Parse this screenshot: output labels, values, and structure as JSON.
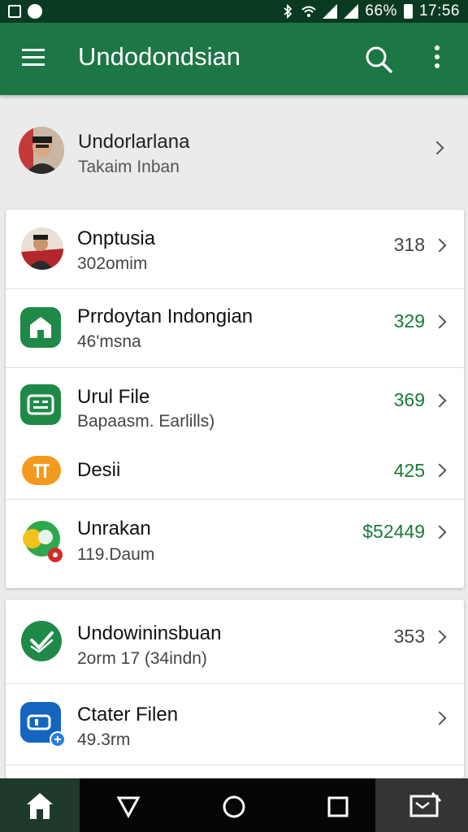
{
  "status_bar": {
    "battery_text": "66%",
    "time": "17:56"
  },
  "app_bar": {
    "title": "Undodondsian"
  },
  "profile": {
    "name": "Undorlarlana",
    "subtitle": "Takaim Inban"
  },
  "list_card_1": [
    {
      "title": "Onptusia",
      "subtitle": "302omim",
      "value": "318",
      "value_color": "gray",
      "icon": "person-avatar"
    },
    {
      "title": "Prrdoytan Indongian",
      "subtitle": "46'msna",
      "value": "329",
      "value_color": "green",
      "icon": "house-icon"
    },
    {
      "title": "Urul File",
      "subtitle": "Bapaasm. Earlills)",
      "value": "369",
      "value_color": "green",
      "icon": "keyboard-icon"
    },
    {
      "title": "Desii",
      "subtitle": "",
      "value": "425",
      "value_color": "green",
      "icon": "design-icon"
    },
    {
      "title": "Unrakan",
      "subtitle": "119.Daum",
      "value": "$52449",
      "value_color": "green",
      "icon": "globe-icon"
    }
  ],
  "list_card_2": [
    {
      "title": "Undowininsbuan",
      "subtitle": "2orm 17 (34indn)",
      "value": "353",
      "value_color": "gray",
      "icon": "check-shield-icon"
    },
    {
      "title": "Ctater Filen",
      "subtitle": "49.3rm",
      "value": "",
      "value_color": "gray",
      "icon": "file-icon"
    }
  ],
  "colors": {
    "app_bar": "#1d7645",
    "status_bar": "#0b3a22",
    "accent_green": "#1a7a3a"
  }
}
